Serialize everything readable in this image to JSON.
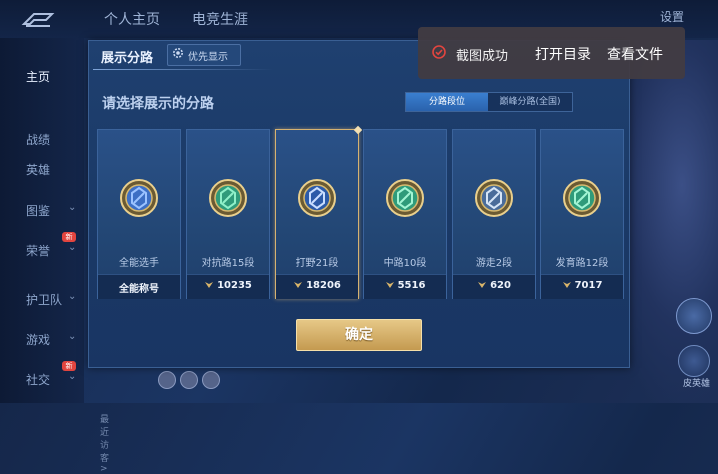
{
  "topbar": {
    "tabs": [
      "个人主页",
      "电竞生涯"
    ],
    "settings_label": "设置"
  },
  "sidebar": {
    "items": [
      {
        "label": "主页",
        "chevron": false,
        "badge": ""
      },
      {
        "label": "战绩",
        "chevron": false,
        "badge": ""
      },
      {
        "label": "英雄",
        "chevron": false,
        "badge": ""
      },
      {
        "label": "图鉴",
        "chevron": true,
        "badge": ""
      },
      {
        "label": "荣誉",
        "chevron": true,
        "badge": "新"
      },
      {
        "label": "护卫队",
        "chevron": true,
        "badge": ""
      },
      {
        "label": "游戏",
        "chevron": true,
        "badge": ""
      },
      {
        "label": "社交",
        "chevron": true,
        "badge": "新"
      }
    ],
    "recent_visitors_label": "最近访客>"
  },
  "right_panel": {
    "badge_label": "皮英雄"
  },
  "dialog": {
    "title": "展示分路",
    "priority_button_label": "优先显示",
    "subtitle": "请选择展示的分路",
    "tabs": {
      "active": "分路段位",
      "inactive": "巅峰分路(全国)"
    },
    "cards": [
      {
        "name": "全能选手",
        "value": "全能称号",
        "show_medal": false,
        "selected": false,
        "emblem": "all-round-emblem-icon"
      },
      {
        "name": "对抗路15段",
        "value": "10235",
        "show_medal": true,
        "selected": false,
        "emblem": "clash-lane-emblem-icon"
      },
      {
        "name": "打野21段",
        "value": "18206",
        "show_medal": true,
        "selected": true,
        "emblem": "jungle-emblem-icon"
      },
      {
        "name": "中路10段",
        "value": "5516",
        "show_medal": true,
        "selected": false,
        "emblem": "mid-lane-emblem-icon"
      },
      {
        "name": "游走2段",
        "value": "620",
        "show_medal": true,
        "selected": false,
        "emblem": "roam-emblem-icon"
      },
      {
        "name": "发育路12段",
        "value": "7017",
        "show_medal": true,
        "selected": false,
        "emblem": "farm-lane-emblem-icon"
      }
    ],
    "confirm_label": "确定"
  },
  "toast": {
    "message": "截图成功",
    "open_dir_label": "打开目录",
    "view_file_label": "查看文件"
  },
  "colors": {
    "gold_accent": "#d6b271",
    "tab_active": "#3a7fd0",
    "toast_bg": "#423c42",
    "success_red": "#e2453f"
  }
}
